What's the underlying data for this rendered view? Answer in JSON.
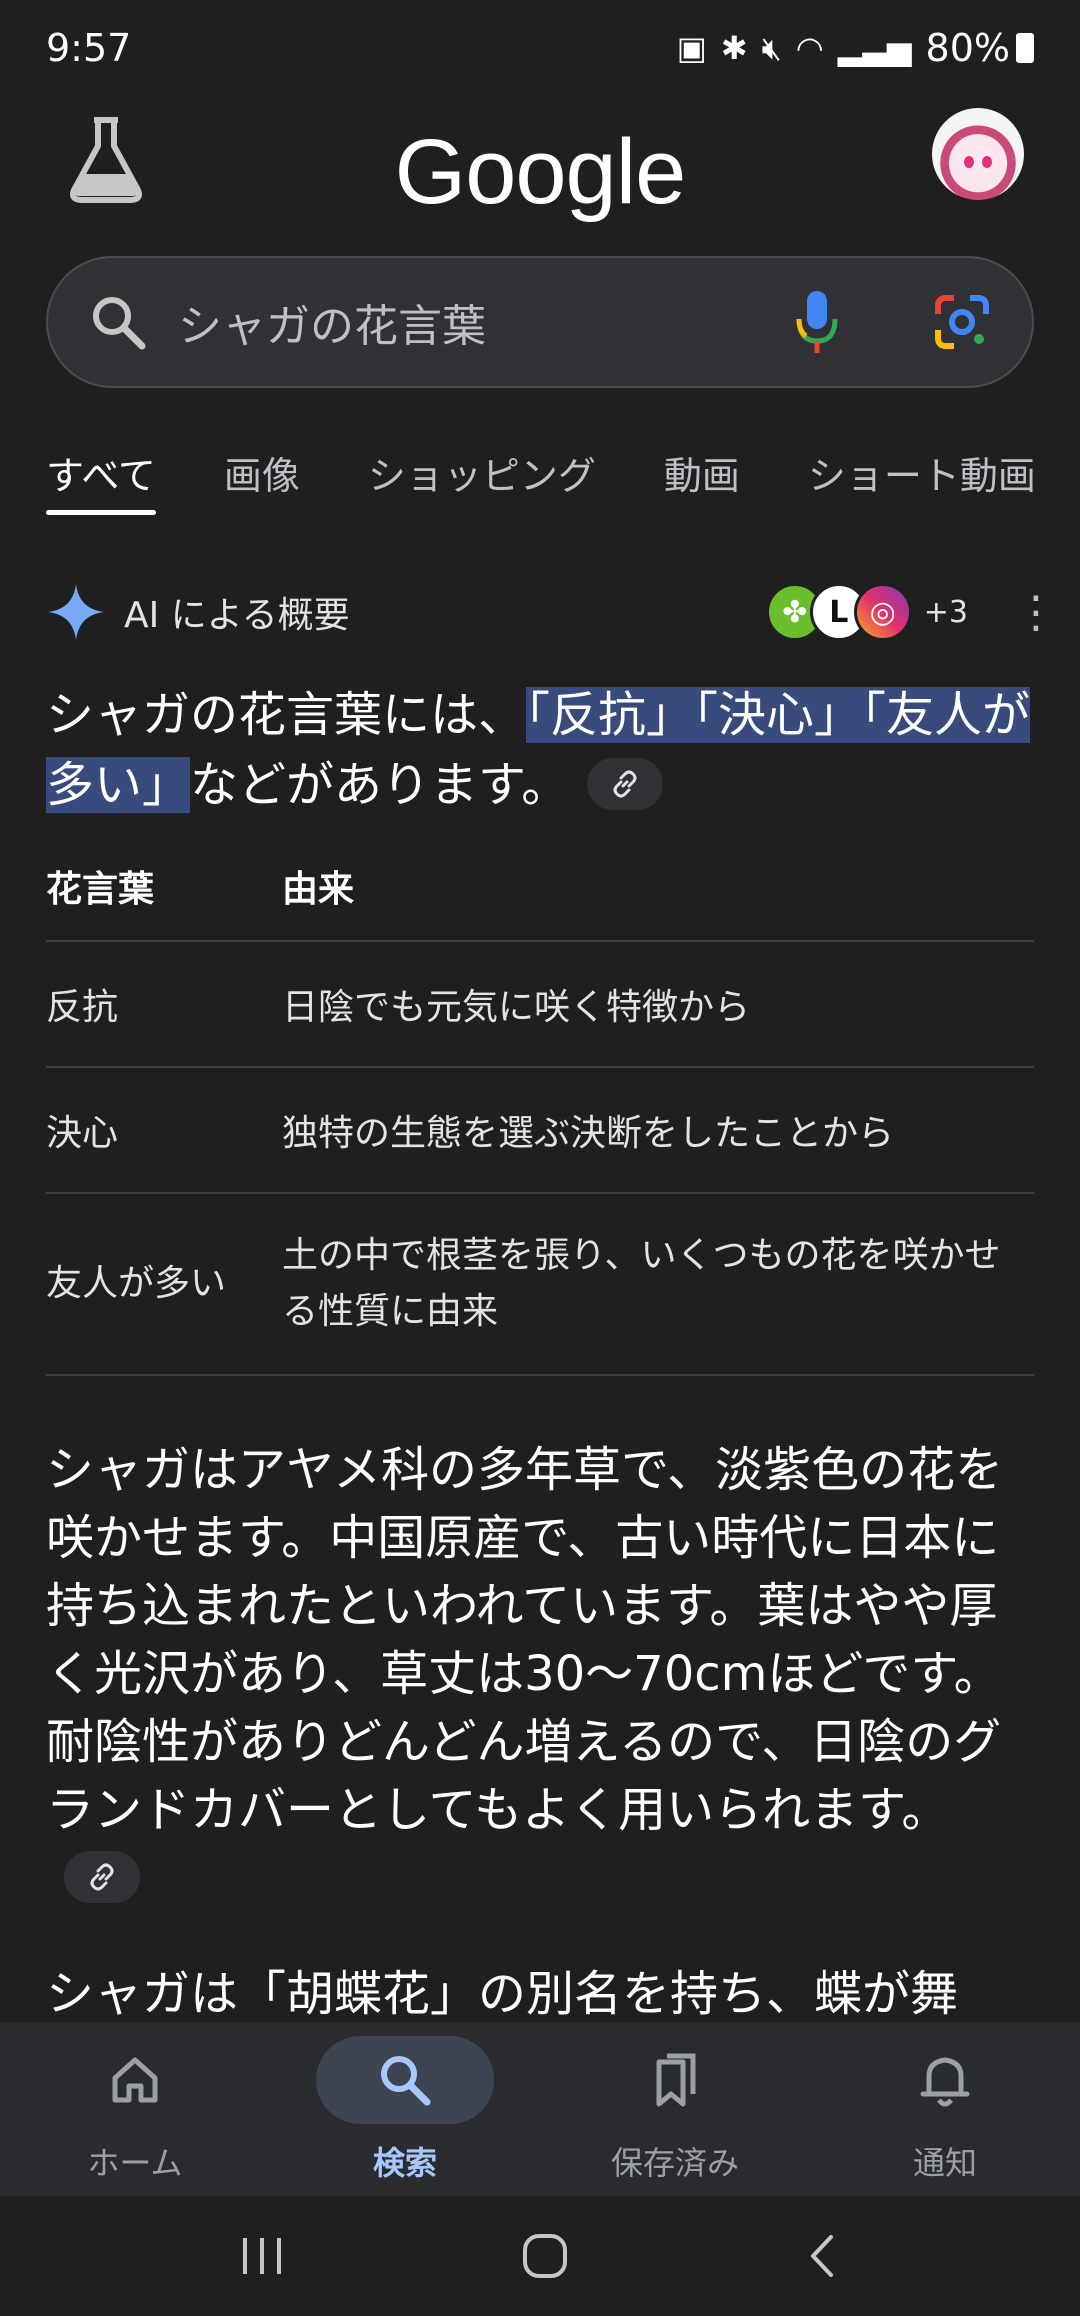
{
  "status_bar": {
    "time": "9:57",
    "battery": "80%"
  },
  "header": {
    "logo": "Google"
  },
  "search": {
    "query": "シャガの花言葉"
  },
  "tabs": [
    {
      "label": "すべて"
    },
    {
      "label": "画像"
    },
    {
      "label": "ショッピング"
    },
    {
      "label": "動画"
    },
    {
      "label": "ショート動画"
    }
  ],
  "ai_overview": {
    "title": "AI による概要",
    "sources_more": "+3",
    "summary_prefix": "シャガの花言葉には、",
    "summary_highlight": "「反抗」「決心」「友人が多い」",
    "summary_suffix": "などがあります。"
  },
  "table": {
    "headers": [
      "花言葉",
      "由来"
    ],
    "rows": [
      {
        "word": "反抗",
        "origin": "日陰でも元気に咲く特徴から"
      },
      {
        "word": "決心",
        "origin": "独特の生態を選ぶ決断をしたことから"
      },
      {
        "word": "友人が多い",
        "origin": "土の中で根茎を張り、いくつもの花を咲かせる性質に由来"
      }
    ]
  },
  "paragraphs": {
    "p1": "シャガはアヤメ科の多年草で、淡紫色の花を咲かせます。中国原産で、古い時代に日本に持ち込まれたといわれています。葉はやや厚く光沢があり、草丈は30〜70cmほどです。耐陰性がありどんどん増えるので、日陰のグランドカバーとしてもよく用いられます。",
    "p2": "シャガは「胡蝶花」の別名を持ち、蝶が舞"
  },
  "bottom_nav": [
    {
      "label": "ホーム"
    },
    {
      "label": "検索"
    },
    {
      "label": "保存済み"
    },
    {
      "label": "通知"
    }
  ],
  "colors": {
    "background": "#1f1f1f",
    "highlight": "#394a7c",
    "active_nav": "#a8c7fa"
  }
}
